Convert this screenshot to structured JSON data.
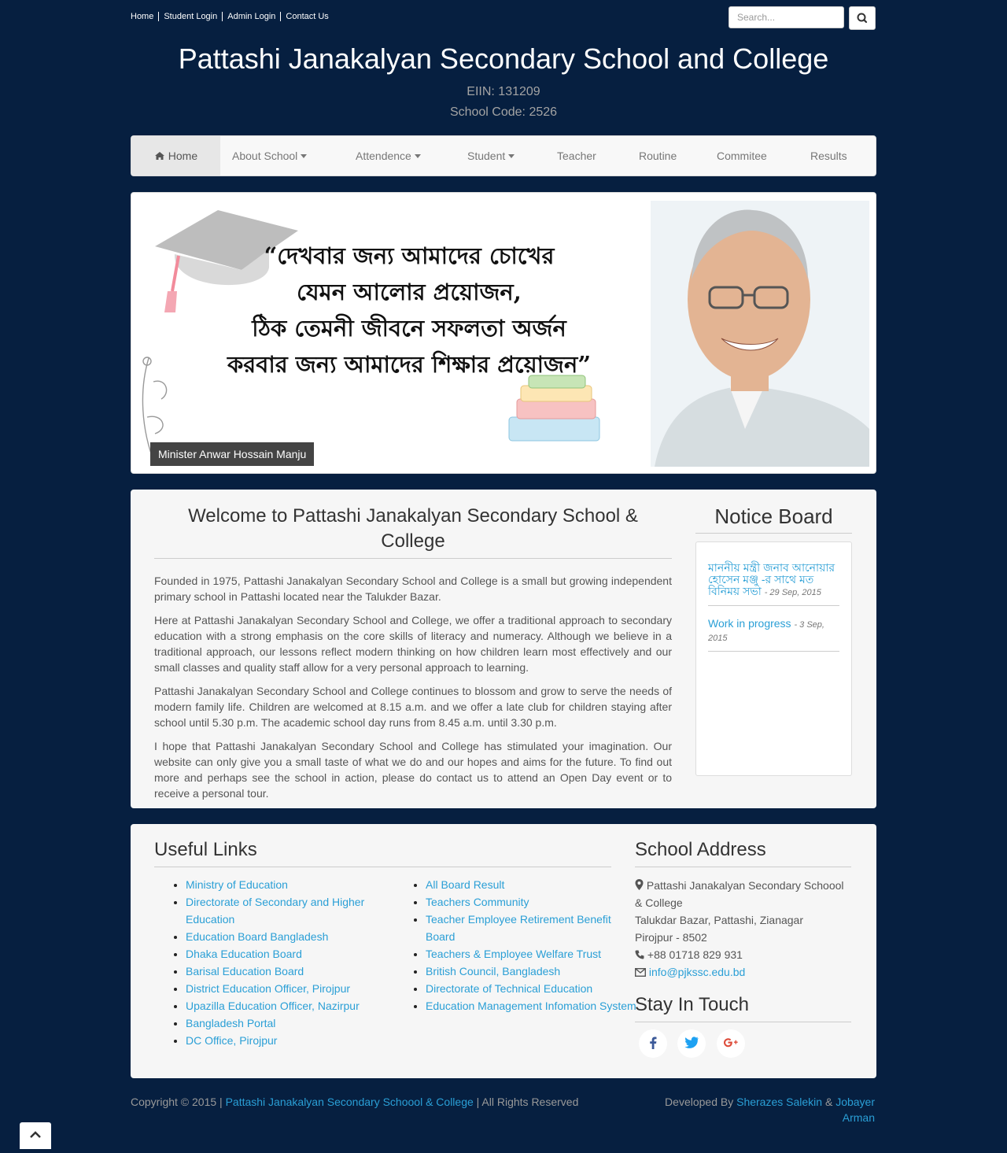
{
  "top_links": [
    "Home",
    "Student Login",
    "Admin Login",
    "Contact Us"
  ],
  "search": {
    "placeholder": "Search..."
  },
  "site": {
    "title": "Pattashi Janakalyan Secondary School and College",
    "eiin": "EIIN: 131209",
    "school_code": "School Code: 2526"
  },
  "nav": {
    "items": [
      {
        "label": "Home",
        "icon": "home-icon",
        "active": true
      },
      {
        "label": "About School",
        "dropdown": true
      },
      {
        "label": "Attendence",
        "dropdown": true
      },
      {
        "label": "Student",
        "dropdown": true
      },
      {
        "label": "Teacher"
      },
      {
        "label": "Routine"
      },
      {
        "label": "Commitee"
      },
      {
        "label": "Results"
      }
    ]
  },
  "slider": {
    "quote_lines": [
      "“দেখবার জন্য আমাদের চোখের",
      "যেমন আলোর প্রয়োজন,",
      "ঠিক তেমনী জীবনে সফলতা অর্জন",
      "করবার জন্য আমাদের শিক্ষার প্রয়োজন”"
    ],
    "caption": "Minister Anwar Hossain Manju"
  },
  "welcome": {
    "heading": "Welcome to Pattashi Janakalyan Secondary School & College",
    "paragraphs": [
      "Founded in 1975, Pattashi Janakalyan Secondary School and College is a small but growing independent primary school in Pattashi located near the Talukder Bazar.",
      "Here at Pattashi Janakalyan Secondary School and College, we offer a traditional approach to secondary education with a strong emphasis on the core skills of literacy and numeracy. Although we believe in a traditional approach, our lessons reflect modern thinking on how children learn most effectively and our small classes and quality staff allow for a very personal approach to learning.",
      "Pattashi Janakalyan Secondary School and College continues to blossom and grow to serve the needs of modern family life. Children are welcomed at 8.15 a.m. and we offer a late club for children staying after school until 5.30 p.m. The academic school day runs from 8.45 a.m. until 3.30 p.m.",
      "I hope that Pattashi Janakalyan Secondary School and College has stimulated your imagination. Our website can only give you a small taste of what we do and our hopes and aims for the future. To find out more and perhaps see the school in action, please do contact us to attend an Open Day event or to receive a personal tour."
    ]
  },
  "notice_board": {
    "heading": "Notice Board",
    "items": [
      {
        "title": "মাননীয় মন্ত্রী জনাব আনোয়ার হোসেন মঞ্জু -র সাথে মত বিনিময় সভা",
        "date": "- 29 Sep, 2015"
      },
      {
        "title": "Work in progress",
        "date": "- 3 Sep, 2015"
      }
    ]
  },
  "useful_links": {
    "heading": "Useful Links",
    "col1": [
      "Ministry of Education",
      "Directorate of Secondary and Higher Education",
      "Education Board Bangladesh",
      "Dhaka Education Board",
      "Barisal Education Board",
      "District Education Officer, Pirojpur",
      "Upazilla Education Officer, Nazirpur",
      "Bangladesh Portal",
      "DC Office, Pirojpur"
    ],
    "col2": [
      "All Board Result",
      "Teachers Community",
      "Teacher Employee Retirement Benefit Board",
      "Teachers & Employee Welfare Trust",
      "British Council, Bangladesh",
      "Directorate of Technical Education",
      "Education Management Infomation System"
    ]
  },
  "address": {
    "heading": "School Address",
    "name": "Pattashi Janakalyan Secondary Schoool & College",
    "line1": "Talukdar Bazar, Pattashi, Zianagar",
    "line2": "Pirojpur - 8502",
    "phone": "+88 01718 829 931",
    "email": "info@pjkssc.edu.bd"
  },
  "stay_in_touch": {
    "heading": "Stay In Touch",
    "icons": [
      "facebook-icon",
      "twitter-icon",
      "google-plus-icon"
    ]
  },
  "footer": {
    "copyright_prefix": "Copyright © 2015 |",
    "copyright_link": "Pattashi Janakalyan Secondary Schoool & College",
    "copyright_suffix": "| All Rights Reserved",
    "developed_by": "Developed By",
    "dev1": "Sherazes Salekin",
    "amp": "&",
    "dev2": "Jobayer Arman"
  },
  "colors": {
    "background": "#061f40",
    "link": "#2a9fd6",
    "panel": "#f6f6f6"
  }
}
